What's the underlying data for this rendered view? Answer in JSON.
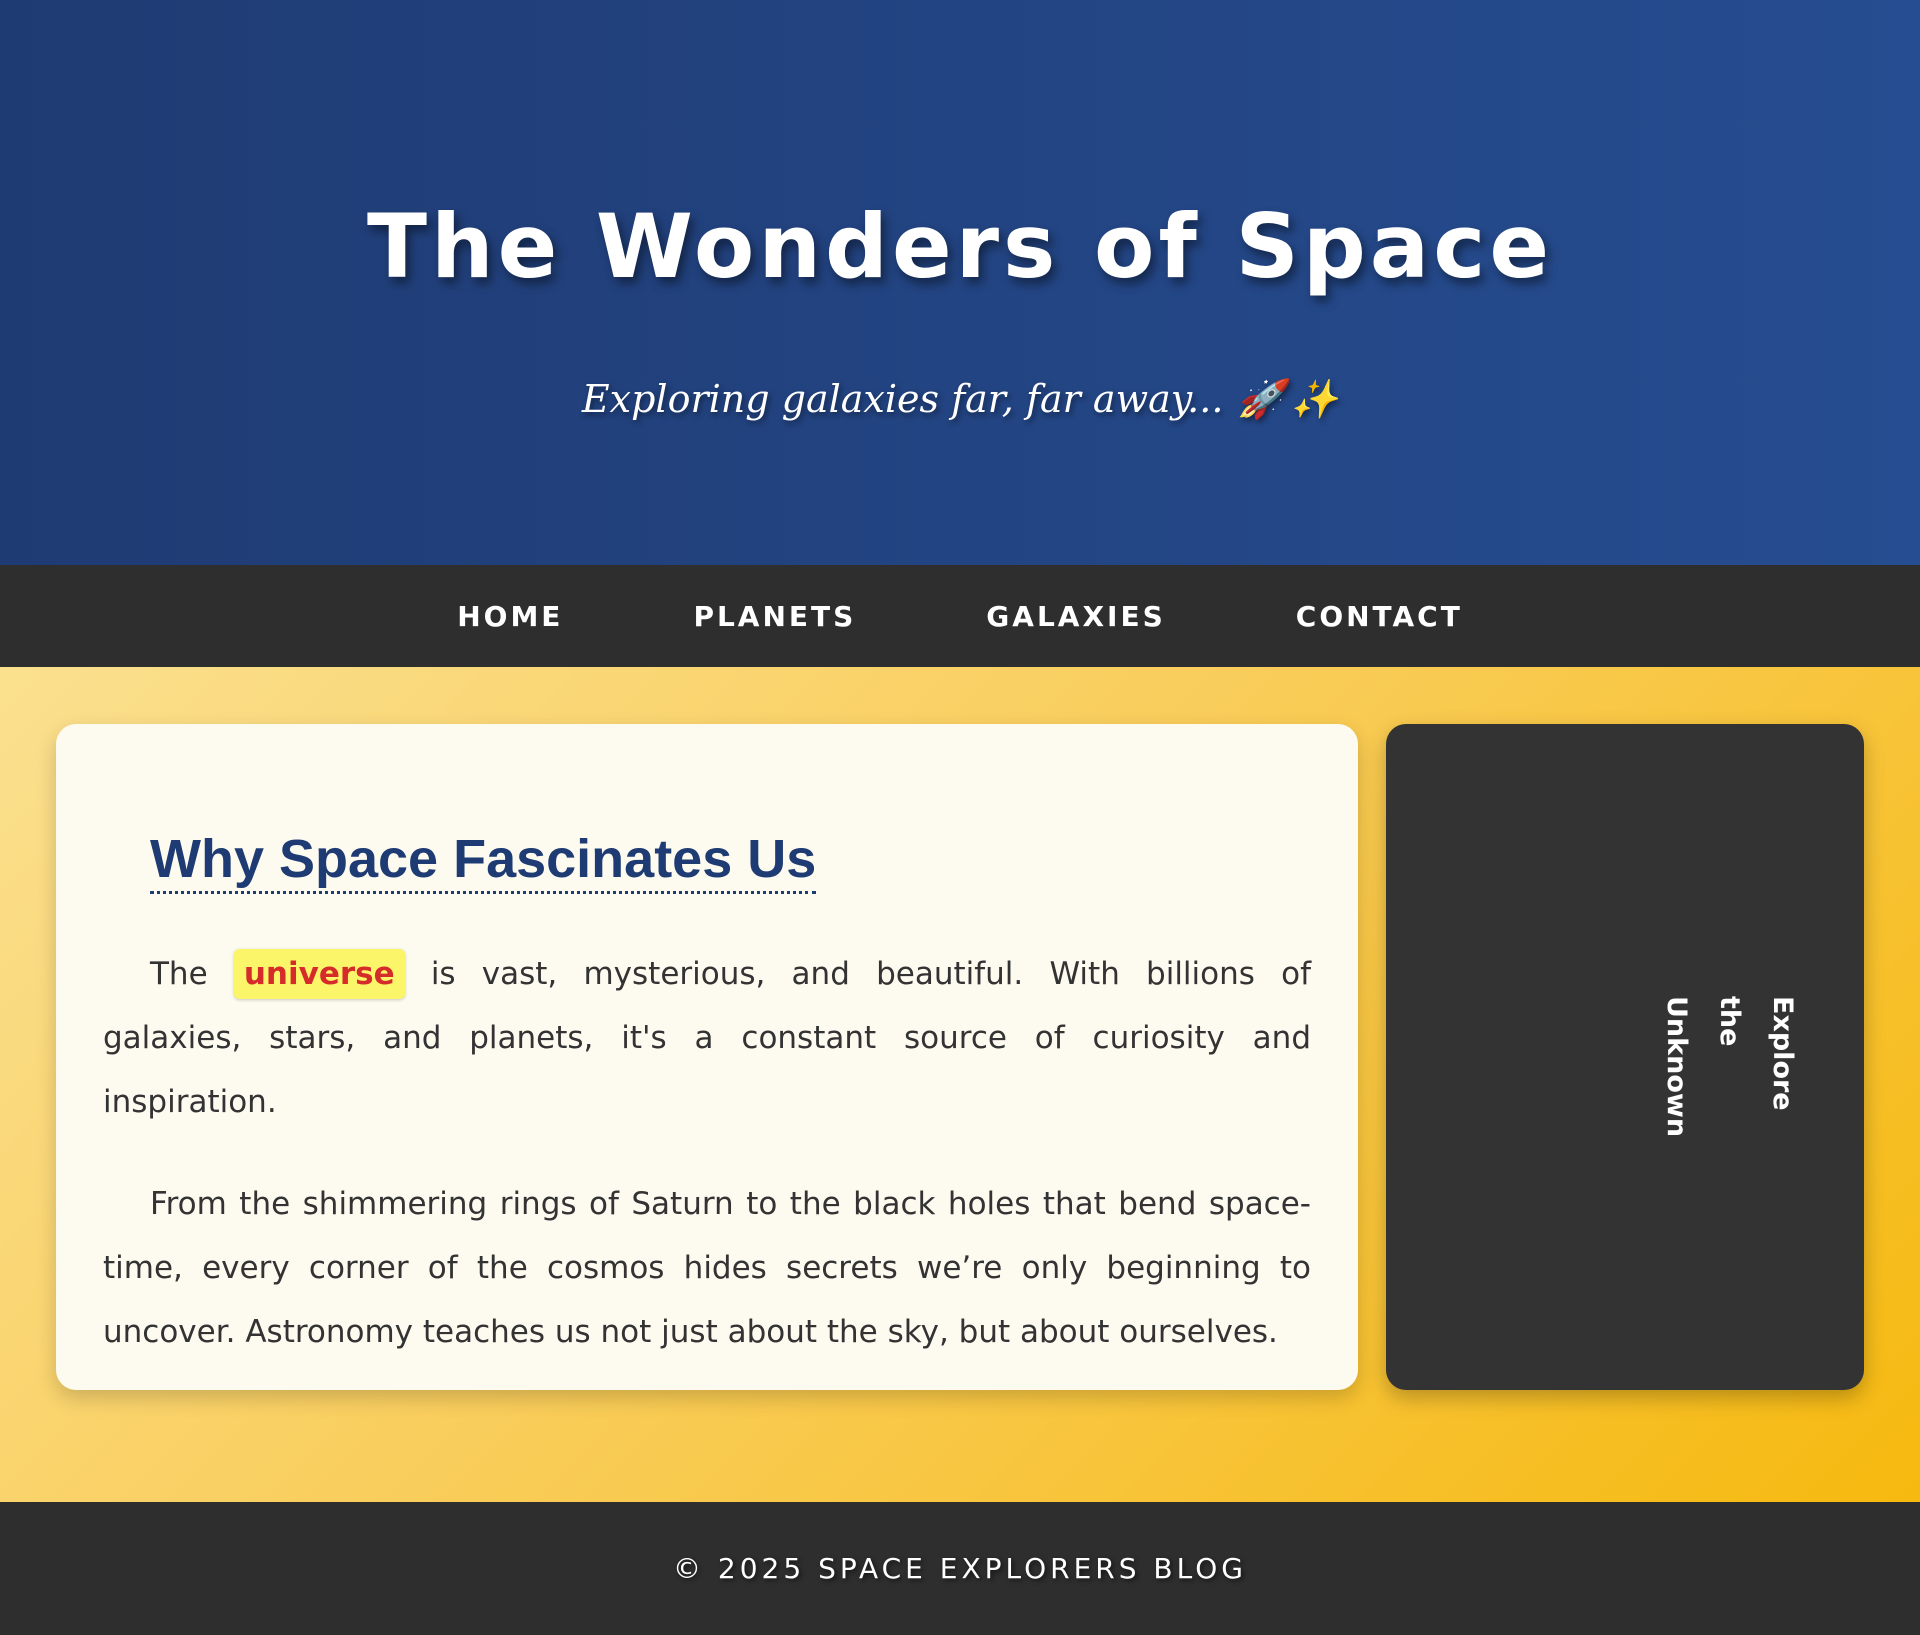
{
  "header": {
    "title": "The Wonders of Space",
    "subtitle": "Exploring galaxies far, far away...",
    "subtitle_icons": [
      "rocket-icon",
      "sparkles-icon"
    ],
    "rocket_glyph": "🚀",
    "sparkles_glyph": "✨"
  },
  "nav": {
    "items": [
      {
        "label": "HOME"
      },
      {
        "label": "PLANETS"
      },
      {
        "label": "GALAXIES"
      },
      {
        "label": "CONTACT"
      }
    ]
  },
  "article": {
    "heading": "Why Space Fascinates Us",
    "p1_before": "The ",
    "p1_highlight": "universe",
    "p1_after": " is vast, mysterious, and beautiful. With billions of galaxies, stars, and planets, it's a constant source of curiosity and inspiration.",
    "p2": "From the shimmering rings of Saturn to the black holes that bend space-time, every corner of the cosmos hides secrets we’re only beginning to uncover. Astronomy teaches us not just about the sky, but about ourselves."
  },
  "sidebar": {
    "text": "Explore the Unknown"
  },
  "footer": {
    "text": "© 2025 SPACE EXPLORERS BLOG"
  },
  "colors": {
    "header_bg": "#1f3b73",
    "nav_bg": "#2e2e2e",
    "accent_yellow": "#f6b90f",
    "highlight_bg": "#fbf56a",
    "highlight_text": "#d62b2b",
    "heading_text": "#1f3b73"
  }
}
